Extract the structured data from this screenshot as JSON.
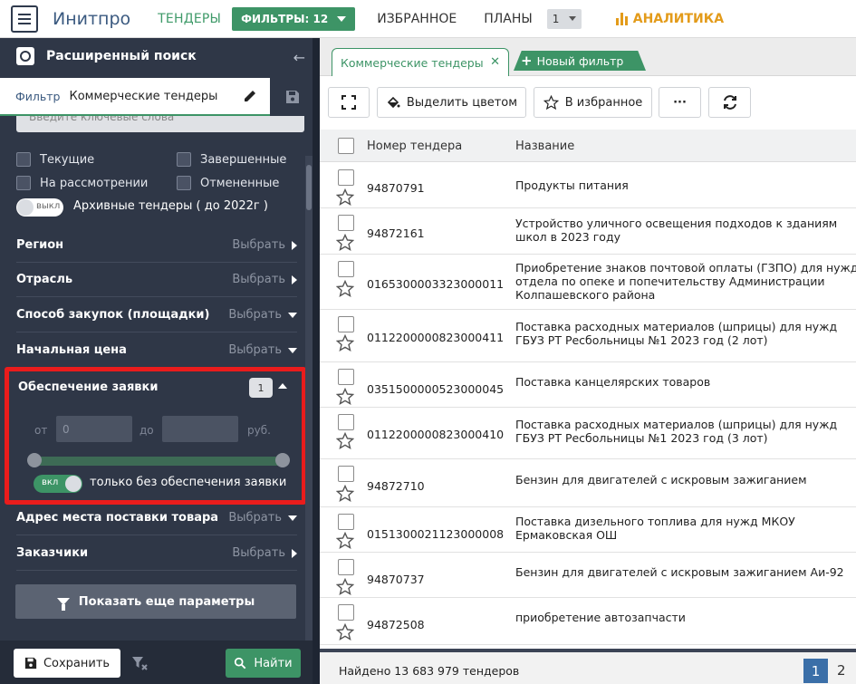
{
  "topbar": {
    "brand": "Инитпро",
    "nav_tenders": "ТЕНДЕРЫ",
    "nav_filters": "ФИЛЬТРЫ: 12",
    "nav_favorites": "ИЗБРАННОЕ",
    "nav_plans": "ПЛАНЫ",
    "plans_count": "1",
    "nav_analytics": "АНАЛИТИКА",
    "colors": {
      "green": "#3d9466",
      "orange": "#e39b1a",
      "brand": "#3b5a80"
    }
  },
  "sidebar": {
    "title": "Расширенный поиск",
    "filter_label": "Фильтр",
    "filter_value": "Коммерческие тендеры",
    "search_placeholder": "Введите ключевые слова",
    "checkboxes": {
      "current": "Текущие",
      "completed": "Завершенные",
      "review": "На рассмотрении",
      "cancelled": "Отмененные"
    },
    "archive_toggle": "выкл",
    "archive_label": "Архивные тендеры ( до 2022г )",
    "params": [
      {
        "name": "Регион",
        "pick": "Выбрать"
      },
      {
        "name": "Отрасль",
        "pick": "Выбрать"
      },
      {
        "name": "Способ закупок (площадки)",
        "pick": "Выбрать"
      },
      {
        "name": "Начальная цена",
        "pick": "Выбрать"
      }
    ],
    "security": {
      "title": "Обеспечение заявки",
      "count": "1",
      "from_label": "от",
      "from_value": "0",
      "to_label": "до",
      "to_value": "",
      "currency": "руб.",
      "toggle_text": "вкл",
      "toggle_label": "только без обеспечения заявки"
    },
    "params2": [
      {
        "name": "Адрес места поставки товара",
        "pick": "Выбрать"
      },
      {
        "name": "Заказчики",
        "pick": "Выбрать"
      }
    ],
    "more_button": "Показать еще параметры",
    "save_button": "Сохранить",
    "find_button": "Найти",
    "highlight_color": "#ea1c1c"
  },
  "main": {
    "tab_active": "Коммерческие тендеры",
    "tab_new": "Новый фильтр",
    "toolbar": {
      "highlight": "Выделить цветом",
      "favorite": "В избранное",
      "more": "···"
    },
    "table": {
      "col_number": "Номер тендера",
      "col_name": "Название",
      "rows": [
        {
          "number": "94870791",
          "name": [
            "Продукты питания"
          ]
        },
        {
          "number": "94872161",
          "name": [
            "Устройство уличного освещения подходов к зданиям",
            "школ в 2023 году"
          ]
        },
        {
          "number": "0165300003323000011",
          "name": [
            "Приобретение знаков почтовой оплаты (ГЗПО) для нужд",
            "отдела по опеке и попечительству Администрации",
            "Колпашевского района"
          ]
        },
        {
          "number": "0112200000823000411",
          "name": [
            "Поставка расходных материалов (шприцы) для нужд",
            "ГБУЗ РТ Ресбольницы №1 2023 год (2 лот)"
          ]
        },
        {
          "number": "0351500000523000045",
          "name": [
            "Поставка канцелярских товаров"
          ]
        },
        {
          "number": "0112200000823000410",
          "name": [
            "Поставка расходных материалов (шприцы) для нужд",
            "ГБУЗ РТ Ресбольницы №1 2023 год (3 лот)"
          ]
        },
        {
          "number": "94872710",
          "name": [
            "Бензин для двигателей с искровым зажиганием"
          ]
        },
        {
          "number": "0151300021123000008",
          "name": [
            "Поставка дизельного топлива для нужд МКОУ",
            "Ермаковская ОШ"
          ]
        },
        {
          "number": "94870737",
          "name": [
            "Бензин для двигателей с искровым зажиганием Аи-92"
          ]
        },
        {
          "number": "94872508",
          "name": [
            "приобретение автозапчасти"
          ]
        }
      ]
    },
    "footer": {
      "found": "Найдено 13 683 979 тендеров",
      "page_current": "1",
      "page_next": "2"
    }
  }
}
